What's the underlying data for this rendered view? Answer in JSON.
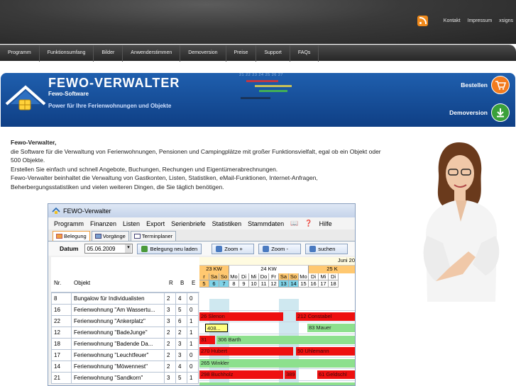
{
  "top_links": [
    "Kontakt",
    "Impressum",
    "xsigns"
  ],
  "nav": [
    "Programm",
    "Funktionsumfang",
    "Bilder",
    "Anwenderstimmen",
    "Demoversion",
    "Preise",
    "Support",
    "FAQs"
  ],
  "banner": {
    "title": "FEWO-VERWALTER",
    "subtitle": "Fewo-Software",
    "slogan": "Power für Ihre Ferienwohnungen und Objekte",
    "order_label": "Bestellen",
    "demo_label": "Demoversion",
    "calendar_days": "21 22 23 24 25 26 27"
  },
  "content": {
    "heading": "Fewo-Verwalter,",
    "p1": "die Software für die Verwaltung von Ferienwohnungen, Pensionen und Campingplätze mit großer Funktionsvielfalt, egal ob ein Objekt oder 500 Objekte.",
    "p2": "Erstellen Sie einfach und schnell Angebote, Buchungen, Rechungen und Eigentümerabrechnungen.",
    "p3": "Fewo-Verwalter beinhaltet die Verwaltung von Gastkonten, Listen, Statistiken, eMail-Funktionen, Internet-Anfragen, Beherbergungsstatistiken und vielen weiteren Dingen, die Sie täglich benötigen."
  },
  "app": {
    "title": "FEWO-Verwalter",
    "menu": [
      "Programm",
      "Finanzen",
      "Listen",
      "Export",
      "Serienbriefe",
      "Statistiken",
      "Stammdaten",
      "Hilfe"
    ],
    "tabs": [
      "Belegung",
      "Vorgänge",
      "Terminplaner"
    ],
    "date_label": "Datum",
    "date_value": "05.06.2009",
    "btn_reload": "Belegung neu laden",
    "btn_zoom_in": "Zoom +",
    "btn_zoom_out": "Zoom -",
    "btn_search": "suchen",
    "month": "Juni 20",
    "weeks": [
      "23 KW",
      "24 KW",
      "25 K"
    ],
    "days": [
      "r",
      "Sa",
      "So",
      "Mo",
      "Di",
      "Mi",
      "Do",
      "Fr",
      "Sa",
      "So",
      "Mo",
      "Di",
      "Mi",
      "Di"
    ],
    "day_nums": [
      "5",
      "6",
      "7",
      "8",
      "9",
      "10",
      "11",
      "12",
      "13",
      "14",
      "15",
      "16",
      "17",
      "18"
    ],
    "columns": {
      "nr": "Nr.",
      "obj": "Objekt",
      "r": "R",
      "b": "B",
      "e": "E"
    },
    "rows": [
      {
        "nr": "8",
        "obj": "Bungalow für Individualisten",
        "r": "2",
        "b": "4",
        "e": "0"
      },
      {
        "nr": "16",
        "obj": "Ferienwohnung \"Am Wassertu...",
        "r": "3",
        "b": "5",
        "e": "0"
      },
      {
        "nr": "22",
        "obj": "Ferienwohnung \"Ankerplatz\"",
        "r": "3",
        "b": "6",
        "e": "1"
      },
      {
        "nr": "12",
        "obj": "Ferienwohnung \"BadeJunge\"",
        "r": "2",
        "b": "2",
        "e": "1"
      },
      {
        "nr": "18",
        "obj": "Ferienwohnung \"Badende Da...",
        "r": "2",
        "b": "3",
        "e": "1"
      },
      {
        "nr": "17",
        "obj": "Ferienwohnung \"Leuchtfeuer\"",
        "r": "2",
        "b": "3",
        "e": "0"
      },
      {
        "nr": "14",
        "obj": "Ferienwohnung \"Möwennest\"",
        "r": "2",
        "b": "4",
        "e": "0"
      },
      {
        "nr": "21",
        "obj": "Ferienwohnung \"Sandkorn\"",
        "r": "3",
        "b": "5",
        "e": "1"
      }
    ],
    "bookings": {
      "r1a": "26 Slenon",
      "r1b": "212 Constabel",
      "r2a": "408...",
      "r2b": "83 Mauer",
      "r3a": "31",
      "r3b": "306 Barth",
      "r4a": "270 Hubert",
      "r4b": "50 Uhlemann",
      "r5a": "265 Winkler",
      "r6a": "298 Buchholz",
      "r6b": "389",
      "r6c": "61 Geldschl"
    }
  }
}
